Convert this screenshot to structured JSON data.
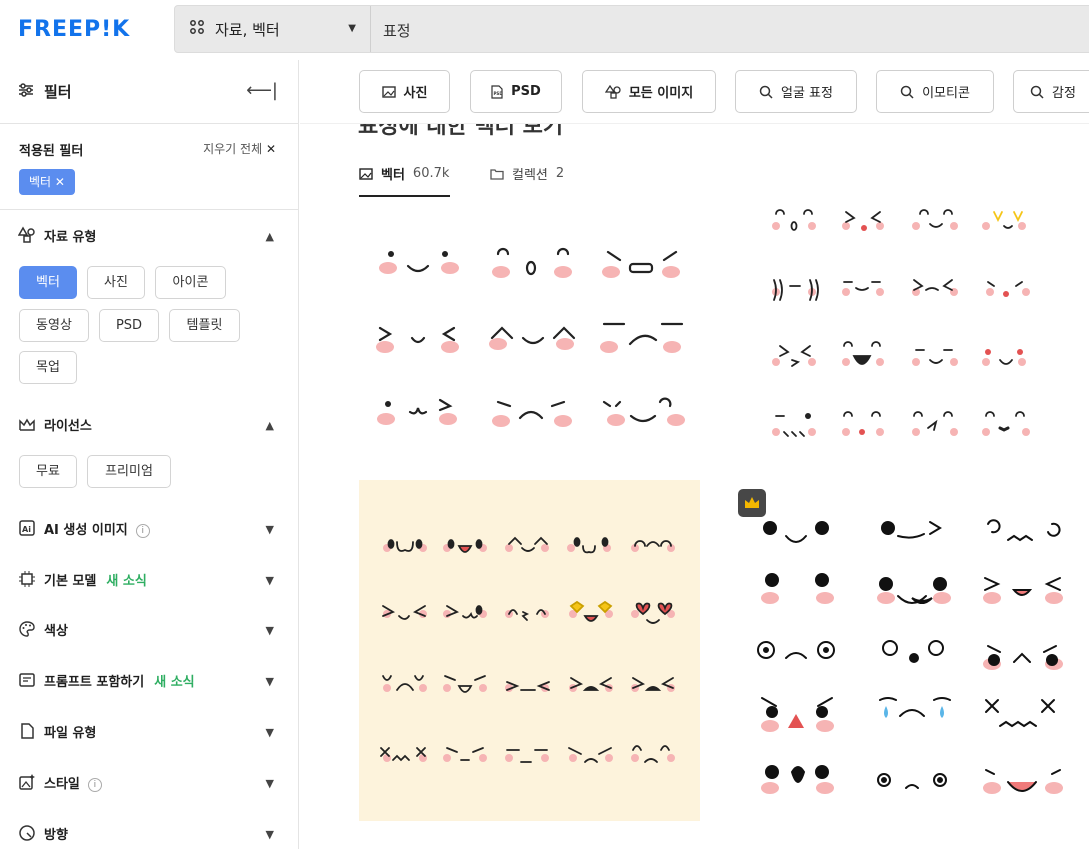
{
  "logo": "FREEP!K",
  "search": {
    "type": "자료, 벡터",
    "query": "표정"
  },
  "sidebar": {
    "title": "필터",
    "applied_title": "적용된 필터",
    "clear_all": "지우기 전체",
    "chip": "벡터",
    "asset_type": {
      "title": "자료 유형",
      "options": [
        "벡터",
        "사진",
        "아이콘",
        "동영상",
        "PSD",
        "템플릿",
        "목업"
      ]
    },
    "license": {
      "title": "라이선스",
      "options": [
        "무료",
        "프리미엄"
      ]
    },
    "sections": [
      {
        "title": "AI 생성 이미지",
        "info": "i"
      },
      {
        "title": "기본 모델",
        "badge": "새 소식"
      },
      {
        "title": "색상"
      },
      {
        "title": "프롬프트 포함하기",
        "badge": "새 소식"
      },
      {
        "title": "파일 유형"
      },
      {
        "title": "스타일",
        "info": "i"
      },
      {
        "title": "방향"
      }
    ]
  },
  "main": {
    "pills": [
      "사진",
      "PSD",
      "모든 이미지",
      "얼굴 표정",
      "이모티콘",
      "감정"
    ],
    "heading_partial": "표정에 대한 벡터 보기",
    "tabs": [
      {
        "label": "벡터",
        "count": "60.7k"
      },
      {
        "label": "컬렉션",
        "count": "2"
      }
    ]
  },
  "colors": {
    "accent": "#5b8def",
    "logo": "#1273eb",
    "new": "#2fae62",
    "blush": "#f6b4b4",
    "cream": "#fdf3dc"
  }
}
